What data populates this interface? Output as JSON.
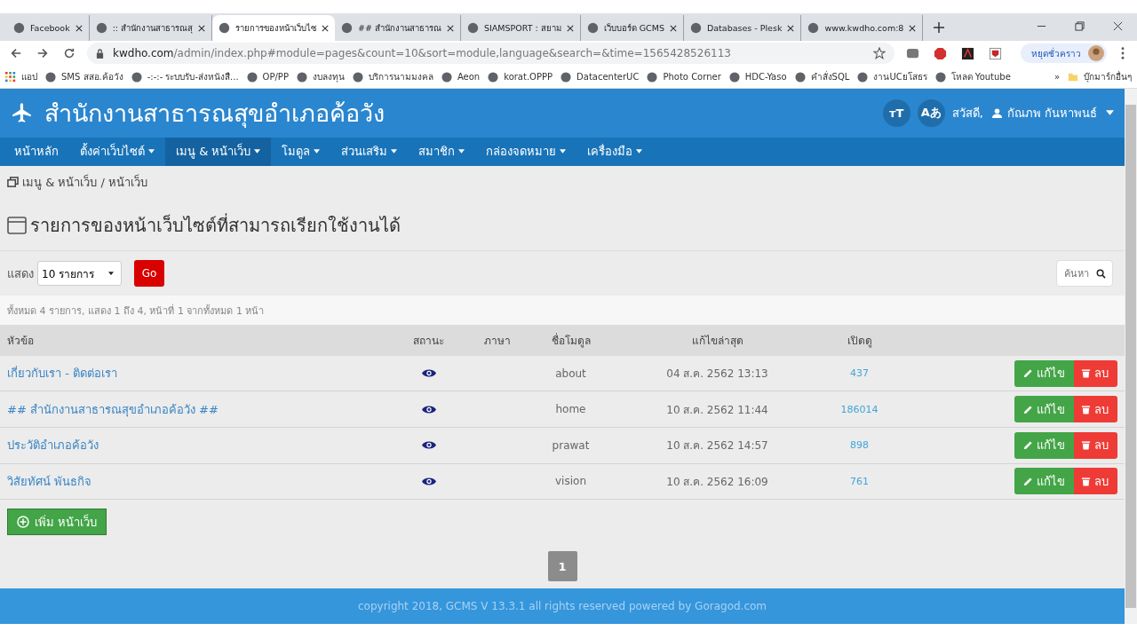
{
  "browser": {
    "tabs": [
      {
        "title": "Facebook",
        "selected": false
      },
      {
        "title": ":: สำนักงานสาธารณสุ",
        "selected": false
      },
      {
        "title": "รายการของหน้าเว็บไซ",
        "selected": true
      },
      {
        "title": "## สำนักงานสาธารณ",
        "selected": false
      },
      {
        "title": "SIAMSPORT : สยาม",
        "selected": false
      },
      {
        "title": "เว็บบอร์ด GCMS",
        "selected": false
      },
      {
        "title": "Databases - Plesk",
        "selected": false
      },
      {
        "title": "www.kwdho.com:8",
        "selected": false
      }
    ],
    "address": {
      "host": "kwdho.com",
      "path": "/admin/index.php#module=pages&count=10&sort=module,language&search=&time=1565428526113"
    },
    "profile_button": "หยุดชั่วคราว",
    "bookmarks": [
      {
        "label": "แอป",
        "kind": "apps"
      },
      {
        "label": "SMS สสอ.ค้อวัง",
        "kind": "site"
      },
      {
        "label": "-:-:- ระบบรับ-ส่งหนังสื...",
        "kind": "site"
      },
      {
        "label": "OP/PP",
        "kind": "site"
      },
      {
        "label": "งบลงทุน",
        "kind": "site"
      },
      {
        "label": "บริการนามมงคล",
        "kind": "site"
      },
      {
        "label": "Aeon",
        "kind": "site"
      },
      {
        "label": "korat.OPPP",
        "kind": "site"
      },
      {
        "label": "DatacenterUC",
        "kind": "site"
      },
      {
        "label": "Photo Corner",
        "kind": "site"
      },
      {
        "label": "HDC-Yaso",
        "kind": "site"
      },
      {
        "label": "คำสั่งSQL",
        "kind": "site"
      },
      {
        "label": "งานUCยโสธร",
        "kind": "site"
      },
      {
        "label": "โหลด Youtube",
        "kind": "site"
      },
      {
        "label": "»",
        "kind": "more"
      },
      {
        "label": "บุ๊กมาร์กอื่นๆ",
        "kind": "folder"
      }
    ]
  },
  "site": {
    "title": "สำนักงานสาธารณสุขอำเภอค้อวัง",
    "header_buttons": [
      "тT",
      "Aあ"
    ],
    "user": {
      "greeting": "สวัสดี,",
      "name": "กัณภพ กันหาพนธ์"
    },
    "nav": [
      {
        "label": "หน้าหลัก",
        "dropdown": false,
        "selected": false
      },
      {
        "label": "ตั้งค่าเว็บไซต์",
        "dropdown": true,
        "selected": false
      },
      {
        "label": "เมนู & หน้าเว็บ",
        "dropdown": true,
        "selected": true
      },
      {
        "label": "โมดูล",
        "dropdown": true,
        "selected": false
      },
      {
        "label": "ส่วนเสริม",
        "dropdown": true,
        "selected": false
      },
      {
        "label": "สมาชิก",
        "dropdown": true,
        "selected": false
      },
      {
        "label": "กล่องจดหมาย",
        "dropdown": true,
        "selected": false
      },
      {
        "label": "เครื่องมือ",
        "dropdown": true,
        "selected": false
      }
    ],
    "breadcrumb": {
      "items": [
        "เมนู & หน้าเว็บ",
        "หน้าเว็บ"
      ],
      "separator": "/"
    },
    "heading": "รายการของหน้าเว็บไซต์ที่สามารถเรียกใช้งานได้",
    "list_controls": {
      "show_label": "แสดง",
      "page_size": "10 รายการ",
      "go_button": "Go",
      "search_placeholder": "ค้นหา"
    },
    "summary": "ทั้งหมด 4 รายการ, แสดง 1 ถึง 4, หน้าที่ 1 จากทั้งหมด 1 หน้า",
    "table": {
      "columns": [
        "หัวข้อ",
        "สถานะ",
        "ภาษา",
        "ชื่อโมดูล",
        "แก้ไขล่าสุด",
        "เปิดดู"
      ],
      "rows": [
        {
          "title": "เกี่ยวกับเรา - ติดต่อเรา",
          "visible": true,
          "module": "about",
          "modified": "04 ส.ค. 2562 13:13",
          "views": "437",
          "edit": "แก้ไข",
          "delete": "ลบ"
        },
        {
          "title": "## สำนักงานสาธารณสุขอำเภอค้อวัง ##",
          "visible": true,
          "module": "home",
          "modified": "10 ส.ค. 2562 11:44",
          "views": "186014",
          "edit": "แก้ไข",
          "delete": "ลบ"
        },
        {
          "title": "ประวัติอำเภอค้อวัง",
          "visible": true,
          "module": "prawat",
          "modified": "10 ส.ค. 2562 14:57",
          "views": "898",
          "edit": "แก้ไข",
          "delete": "ลบ"
        },
        {
          "title": "วิสัยทัศน์ พันธกิจ",
          "visible": true,
          "module": "vision",
          "modified": "10 ส.ค. 2562 16:09",
          "views": "761",
          "edit": "แก้ไข",
          "delete": "ลบ"
        }
      ]
    },
    "add_button": "เพิ่ม หน้าเว็บ",
    "pagination": [
      {
        "label": "1",
        "selected": true
      }
    ],
    "footer": "copyright 2018, GCMS V 13.3.1 all rights reserved powered by Goragod.com"
  }
}
